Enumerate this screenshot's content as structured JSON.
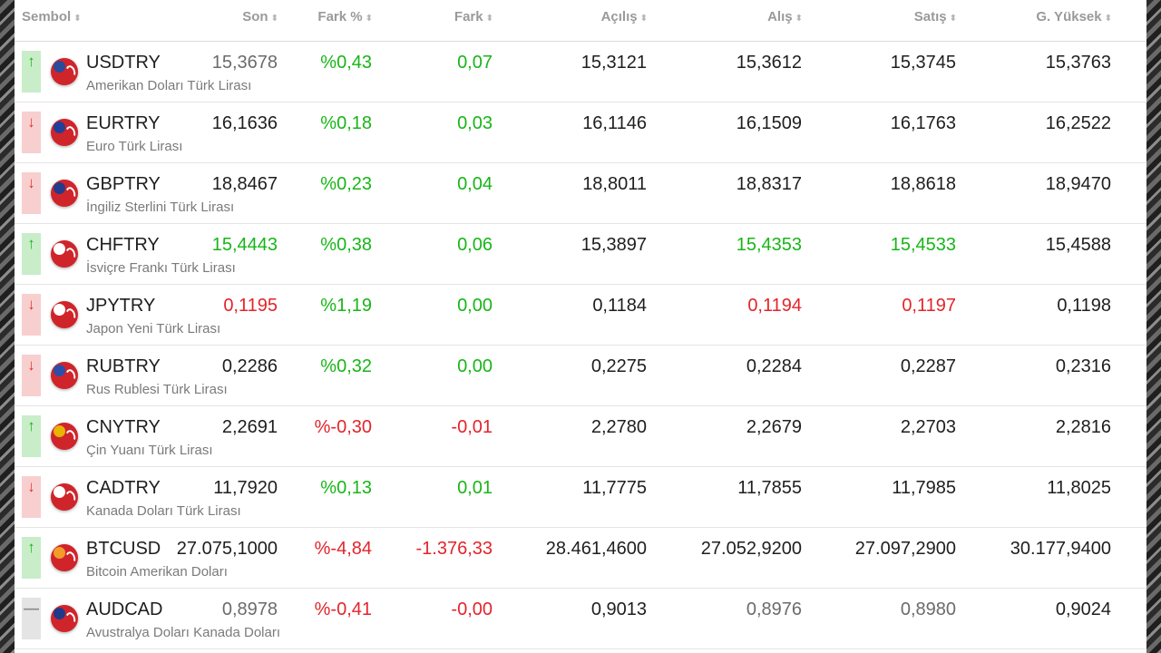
{
  "header": {
    "columns": [
      "Sembol",
      "Son",
      "Fark %",
      "Fark",
      "Açılış",
      "Alış",
      "Satış",
      "G. Yüksek"
    ],
    "sort_glyph": "⬍"
  },
  "colors": {
    "up": "#17b617",
    "down": "#e3242b",
    "neutral": "#1e1e1e"
  },
  "rows": [
    {
      "direction": "up",
      "arrow": "↑",
      "flag_icon": "us-flag-icon",
      "flag_color": "#2a4a9a",
      "symbol": "USDTRY",
      "name": "Amerikan Doları Türk Lirası",
      "son": "15,3678",
      "son_color": "gray",
      "fark_pct": "%0,43",
      "fark_pct_color": "green",
      "fark": "0,07",
      "fark_color": "green",
      "acilis": "15,3121",
      "alis": "15,3612",
      "alis_color": "dark",
      "satis": "15,3745",
      "satis_color": "dark",
      "yuksek": "15,3763"
    },
    {
      "direction": "down",
      "arrow": "↓",
      "flag_icon": "eu-flag-icon",
      "flag_color": "#1f3f99",
      "symbol": "EURTRY",
      "name": "Euro Türk Lirası",
      "son": "16,1636",
      "son_color": "dark",
      "fark_pct": "%0,18",
      "fark_pct_color": "green",
      "fark": "0,03",
      "fark_color": "green",
      "acilis": "16,1146",
      "alis": "16,1509",
      "alis_color": "dark",
      "satis": "16,1763",
      "satis_color": "dark",
      "yuksek": "16,2522"
    },
    {
      "direction": "down",
      "arrow": "↓",
      "flag_icon": "gb-flag-icon",
      "flag_color": "#243a8a",
      "symbol": "GBPTRY",
      "name": "İngiliz Sterlini Türk Lirası",
      "son": "18,8467",
      "son_color": "dark",
      "fark_pct": "%0,23",
      "fark_pct_color": "green",
      "fark": "0,04",
      "fark_color": "green",
      "acilis": "18,8011",
      "alis": "18,8317",
      "alis_color": "dark",
      "satis": "18,8618",
      "satis_color": "dark",
      "yuksek": "18,9470"
    },
    {
      "direction": "up",
      "arrow": "↑",
      "flag_icon": "ch-flag-icon",
      "flag_color": "#ffffff",
      "symbol": "CHFTRY",
      "name": "İsviçre Frankı Türk Lirası",
      "son": "15,4443",
      "son_color": "green",
      "fark_pct": "%0,38",
      "fark_pct_color": "green",
      "fark": "0,06",
      "fark_color": "green",
      "acilis": "15,3897",
      "alis": "15,4353",
      "alis_color": "green",
      "satis": "15,4533",
      "satis_color": "green",
      "yuksek": "15,4588"
    },
    {
      "direction": "down",
      "arrow": "↓",
      "flag_icon": "jp-flag-icon",
      "flag_color": "#ffffff",
      "symbol": "JPYTRY",
      "name": "Japon Yeni Türk Lirası",
      "son": "0,1195",
      "son_color": "red",
      "fark_pct": "%1,19",
      "fark_pct_color": "green",
      "fark": "0,00",
      "fark_color": "green",
      "acilis": "0,1184",
      "alis": "0,1194",
      "alis_color": "red",
      "satis": "0,1197",
      "satis_color": "red",
      "yuksek": "0,1198"
    },
    {
      "direction": "down",
      "arrow": "↓",
      "flag_icon": "ru-flag-icon",
      "flag_color": "#2c4ea8",
      "symbol": "RUBTRY",
      "name": "Rus Rublesi Türk Lirası",
      "son": "0,2286",
      "son_color": "dark",
      "fark_pct": "%0,32",
      "fark_pct_color": "green",
      "fark": "0,00",
      "fark_color": "green",
      "acilis": "0,2275",
      "alis": "0,2284",
      "alis_color": "dark",
      "satis": "0,2287",
      "satis_color": "dark",
      "yuksek": "0,2316"
    },
    {
      "direction": "up",
      "arrow": "↑",
      "flag_icon": "cn-flag-icon",
      "flag_color": "#e8b400",
      "symbol": "CNYTRY",
      "name": "Çin Yuanı Türk Lirası",
      "son": "2,2691",
      "son_color": "dark",
      "fark_pct": "%-0,30",
      "fark_pct_color": "red",
      "fark": "-0,01",
      "fark_color": "red",
      "acilis": "2,2780",
      "alis": "2,2679",
      "alis_color": "dark",
      "satis": "2,2703",
      "satis_color": "dark",
      "yuksek": "2,2816"
    },
    {
      "direction": "down",
      "arrow": "↓",
      "flag_icon": "ca-flag-icon",
      "flag_color": "#ffffff",
      "symbol": "CADTRY",
      "name": "Kanada Doları Türk Lirası",
      "son": "11,7920",
      "son_color": "dark",
      "fark_pct": "%0,13",
      "fark_pct_color": "green",
      "fark": "0,01",
      "fark_color": "green",
      "acilis": "11,7775",
      "alis": "11,7855",
      "alis_color": "dark",
      "satis": "11,7985",
      "satis_color": "dark",
      "yuksek": "11,8025"
    },
    {
      "direction": "up",
      "arrow": "↑",
      "flag_icon": "btc-icon",
      "flag_color": "#f39c2a",
      "symbol": "BTCUSD",
      "name": "Bitcoin Amerikan Doları",
      "son": "27.075,1000",
      "son_color": "dark",
      "fark_pct": "%-4,84",
      "fark_pct_color": "red",
      "fark": "-1.376,33",
      "fark_color": "red",
      "acilis": "28.461,4600",
      "alis": "27.052,9200",
      "alis_color": "dark",
      "satis": "27.097,2900",
      "satis_color": "dark",
      "yuksek": "30.177,9400"
    },
    {
      "direction": "flat",
      "arrow": "—",
      "flag_icon": "au-flag-icon",
      "flag_color": "#1f3a8a",
      "symbol": "AUDCAD",
      "name": "Avustralya Doları Kanada Doları",
      "son": "0,8978",
      "son_color": "gray",
      "fark_pct": "%-0,41",
      "fark_pct_color": "red",
      "fark": "-0,00",
      "fark_color": "red",
      "acilis": "0,9013",
      "alis": "0,8976",
      "alis_color": "gray",
      "satis": "0,8980",
      "satis_color": "gray",
      "yuksek": "0,9024"
    }
  ]
}
